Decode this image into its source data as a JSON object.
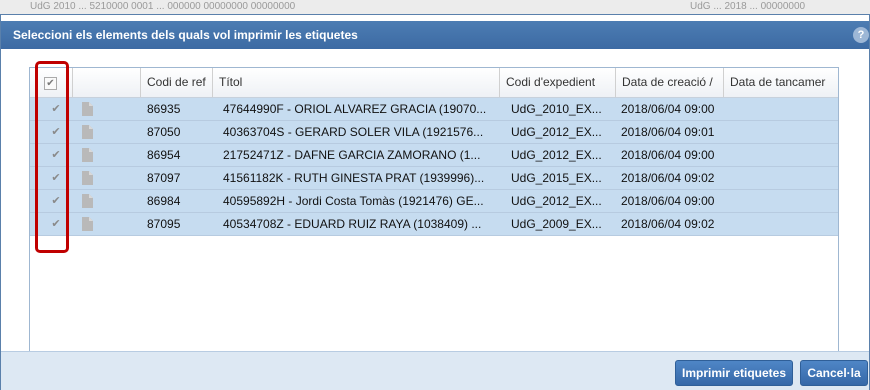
{
  "background": {
    "left_text": "UdG 2010 ... 5210000 0001 ... 000000 00000000 00000000",
    "right_text": "UdG ... 2018 ... 00000000"
  },
  "dialog": {
    "title": "Seleccioni els elements dels quals vol imprimir les etiquetes",
    "help": "?"
  },
  "grid": {
    "columns": [
      "Codi de ref",
      "Títol",
      "Codi d'expedient",
      "Data de creació /",
      "Data de tancamer"
    ],
    "header_checkbox": "✔",
    "rows": [
      {
        "checked": "✔",
        "ref": "86935",
        "title": "47644990F - ORIOL ALVAREZ GRACIA (19070...",
        "expedient": "UdG_2010_EX...",
        "created": "2018/06/04 09:00",
        "closed": ""
      },
      {
        "checked": "✔",
        "ref": "87050",
        "title": "40363704S - GERARD SOLER VILA (1921576...",
        "expedient": "UdG_2012_EX...",
        "created": "2018/06/04 09:01",
        "closed": ""
      },
      {
        "checked": "✔",
        "ref": "86954",
        "title": "21752471Z - DAFNE GARCIA ZAMORANO (1...",
        "expedient": "UdG_2012_EX...",
        "created": "2018/06/04 09:00",
        "closed": ""
      },
      {
        "checked": "✔",
        "ref": "87097",
        "title": "41561182K - RUTH GINESTA PRAT (1939996)...",
        "expedient": "UdG_2015_EX...",
        "created": "2018/06/04 09:02",
        "closed": ""
      },
      {
        "checked": "✔",
        "ref": "86984",
        "title": "40595892H - Jordi Costa Tomàs (1921476) GE...",
        "expedient": "UdG_2012_EX...",
        "created": "2018/06/04 09:00",
        "closed": ""
      },
      {
        "checked": "✔",
        "ref": "87095",
        "title": "40534708Z - EDUARD RUIZ RAYA (1038409) ...",
        "expedient": "UdG_2009_EX...",
        "created": "2018/06/04 09:02",
        "closed": ""
      }
    ]
  },
  "footer": {
    "print_label": "Imprimir etiquetes",
    "cancel_label": "Cancel·la"
  },
  "colors": {
    "title_bar": "#3c6aa3",
    "row_selected": "#c6dcf0",
    "highlight": "#c00000",
    "button": "#3568a8"
  }
}
